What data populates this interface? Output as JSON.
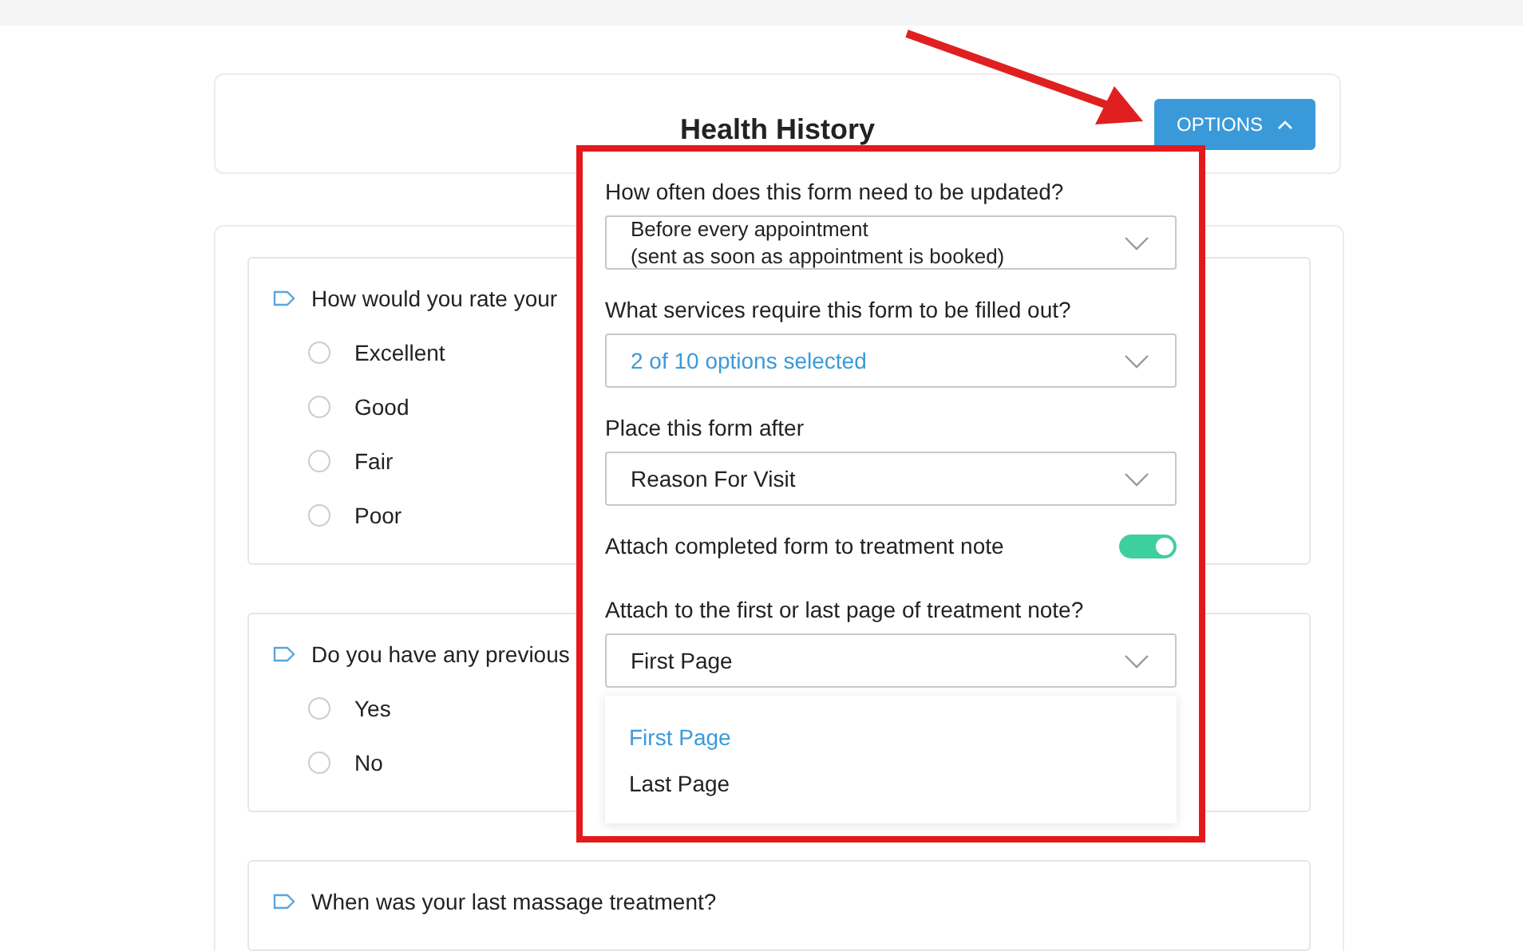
{
  "header": {
    "title": "Health History",
    "options_button": {
      "label": "OPTIONS",
      "expanded": true
    }
  },
  "questions": [
    {
      "text": "How would you rate your",
      "options": [
        {
          "label": "Excellent",
          "selected": false
        },
        {
          "label": "Good",
          "selected": false
        },
        {
          "label": "Fair",
          "selected": false
        },
        {
          "label": "Poor",
          "selected": false
        }
      ]
    },
    {
      "text": "Do you have any previous",
      "options": [
        {
          "label": "Yes",
          "selected": false
        },
        {
          "label": "No",
          "selected": false
        }
      ]
    },
    {
      "text": "When was your last massage treatment?"
    }
  ],
  "popover": {
    "fields": [
      {
        "kind": "select",
        "label": "How often does this form need to be updated?",
        "value_lines": [
          "Before every appointment",
          "(sent as soon as appointment is booked)"
        ],
        "highlighted": false
      },
      {
        "kind": "select",
        "label": "What services require this form to be filled out?",
        "value_lines": [
          "2 of 10 options selected"
        ],
        "highlighted": true
      },
      {
        "kind": "select",
        "label": "Place this form after",
        "value_lines": [
          "Reason For Visit"
        ],
        "highlighted": false
      },
      {
        "kind": "toggle",
        "label": "Attach completed form to treatment note",
        "on": true
      },
      {
        "kind": "select",
        "label": "Attach to the first or last page of treatment note?",
        "value_lines": [
          "First Page"
        ],
        "highlighted": false,
        "options": [
          {
            "label": "First Page",
            "selected": true
          },
          {
            "label": "Last Page",
            "selected": false
          }
        ]
      }
    ]
  }
}
